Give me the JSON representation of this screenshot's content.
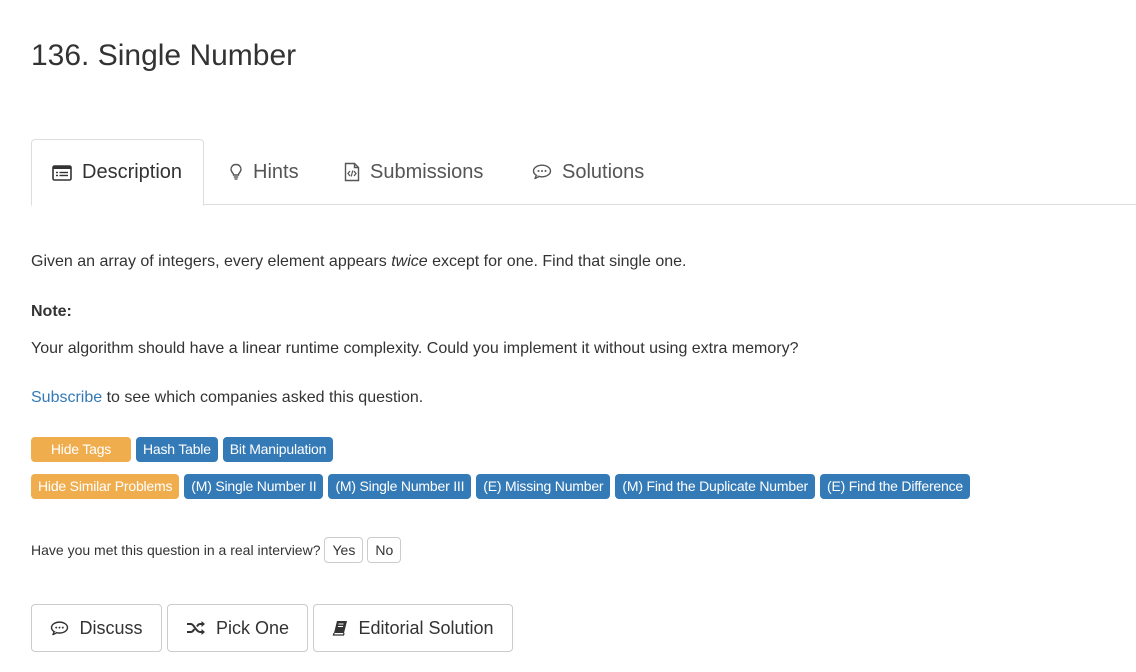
{
  "problem": {
    "title": "136. Single Number"
  },
  "tabs": [
    {
      "label": "Description",
      "icon": "description-icon"
    },
    {
      "label": "Hints",
      "icon": "lightbulb-icon"
    },
    {
      "label": "Submissions",
      "icon": "code-file-icon"
    },
    {
      "label": "Solutions",
      "icon": "comment-icon"
    }
  ],
  "description": {
    "line1_before": "Given an array of integers, every element appears ",
    "line1_em": "twice",
    "line1_after": " except for one. Find that single one.",
    "note_label": "Note:",
    "note_text": "Your algorithm should have a linear runtime complexity. Could you implement it without using extra memory?",
    "subscribe_link": "Subscribe",
    "subscribe_text": " to see which companies asked this question."
  },
  "tags": {
    "hide_label": "Hide Tags",
    "items": [
      "Hash Table",
      "Bit Manipulation"
    ]
  },
  "similar": {
    "hide_label": "Hide Similar Problems",
    "items": [
      "(M) Single Number II",
      "(M) Single Number III",
      "(E) Missing Number",
      "(M) Find the Duplicate Number",
      "(E) Find the Difference"
    ]
  },
  "interview": {
    "question": "Have you met this question in a real interview?",
    "yes_label": "Yes",
    "no_label": "No"
  },
  "actions": {
    "discuss_label": "Discuss",
    "pick_one_label": "Pick One",
    "editorial_label": "Editorial Solution"
  },
  "colors": {
    "primary_blue": "#337ab7",
    "warning_orange": "#f0ad4e",
    "text": "#333333",
    "border": "#dddddd"
  }
}
